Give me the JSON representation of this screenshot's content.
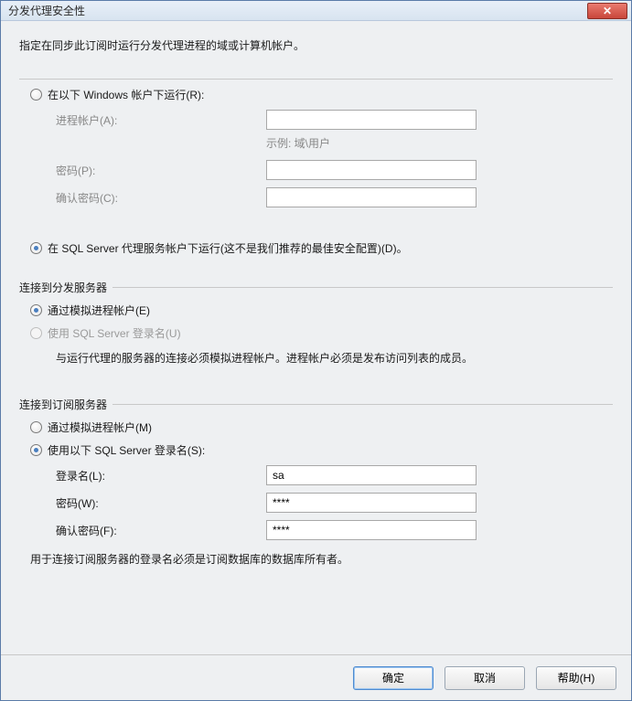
{
  "title": "分发代理安全性",
  "instruction": "指定在同步此订阅时运行分发代理进程的域或计算机帐户。",
  "top": {
    "line": {
      "exists": true
    },
    "radio1": {
      "label": "在以下 Windows 帐户下运行(R):",
      "checked": false
    },
    "fields": {
      "process_account_label": "进程帐户(A):",
      "process_account_value": "",
      "hint": "示例: 域\\用户",
      "password_label": "密码(P):",
      "password_value": "",
      "confirm_label": "确认密码(C):",
      "confirm_value": ""
    },
    "radio2": {
      "label": "在 SQL Server 代理服务帐户下运行(这不是我们推荐的最佳安全配置)(D)。",
      "checked": true
    }
  },
  "distributor": {
    "title": "连接到分发服务器",
    "radio1": {
      "label": "通过模拟进程帐户(E)",
      "checked": true
    },
    "radio2": {
      "label": "使用 SQL Server 登录名(U)",
      "checked": false,
      "disabled": true
    },
    "note": "与运行代理的服务器的连接必须模拟进程帐户。进程帐户必须是发布访问列表的成员。"
  },
  "subscriber": {
    "title": "连接到订阅服务器",
    "radio1": {
      "label": "通过模拟进程帐户(M)",
      "checked": false
    },
    "radio2": {
      "label": "使用以下 SQL Server 登录名(S):",
      "checked": true
    },
    "fields": {
      "login_label": "登录名(L):",
      "login_value": "sa",
      "password_label": "密码(W):",
      "password_value": "****",
      "confirm_label": "确认密码(F):",
      "confirm_value": "****"
    },
    "note": "用于连接订阅服务器的登录名必须是订阅数据库的数据库所有者。"
  },
  "buttons": {
    "ok": "确定",
    "cancel": "取消",
    "help": "帮助(H)"
  }
}
